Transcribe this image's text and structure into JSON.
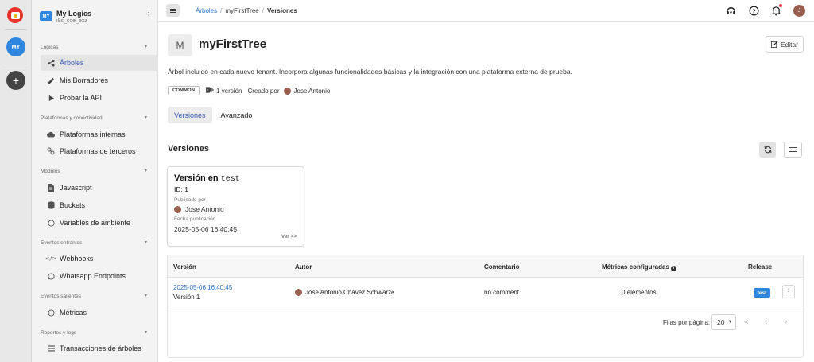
{
  "rail": {
    "workspace_initials": "MY",
    "add_label": "+"
  },
  "org": {
    "badge": "MY",
    "name": "My Logics",
    "id": "i8s_soe_exz",
    "menu": "⋮"
  },
  "sidebar": {
    "sections": [
      {
        "title": "Lógicas",
        "items": [
          {
            "label": "Árboles",
            "icon": "share-icon",
            "active": true
          },
          {
            "label": "Mis Borradores",
            "icon": "edit-icon"
          },
          {
            "label": "Probar la API",
            "icon": "play-icon"
          }
        ]
      },
      {
        "title": "Plataformas y conectividad",
        "items": [
          {
            "label": "Plataformas internas",
            "icon": "cloud-icon"
          },
          {
            "label": "Plataformas de terceros",
            "icon": "nodes-icon"
          }
        ]
      },
      {
        "title": "Módulos",
        "items": [
          {
            "label": "Javascript",
            "icon": "file-icon"
          },
          {
            "label": "Buckets",
            "icon": "database-icon"
          },
          {
            "label": "Variables de ambiente",
            "icon": "circle-icon"
          }
        ]
      },
      {
        "title": "Eventos entrantes",
        "items": [
          {
            "label": "Webhooks",
            "icon": "code-icon"
          },
          {
            "label": "Whatsapp Endpoints",
            "icon": "whatsapp-icon"
          }
        ]
      },
      {
        "title": "Eventos salientes",
        "items": [
          {
            "label": "Métricas",
            "icon": "circle-icon"
          }
        ]
      },
      {
        "title": "Reportes y logs",
        "items": [
          {
            "label": "Transacciones de árboles",
            "icon": "list-icon"
          }
        ]
      }
    ]
  },
  "breadcrumb": {
    "items": [
      "Árboles",
      "myFirstTree",
      "Versiones"
    ],
    "separator": "/"
  },
  "user": {
    "initial": "J"
  },
  "tree": {
    "initial": "M",
    "name": "myFirstTree",
    "edit_label": "Editar",
    "description": "Árbol incluido en cada nuevo tenant. Incorpora algunas funcionalidades básicas y la integración con una plataforma externa de prueba.",
    "tag": "COMMON",
    "versions_count": "1 versión",
    "created_by_label": "Creado por",
    "created_by": "Jose Antonio"
  },
  "tabs": [
    {
      "label": "Versiones",
      "active": true
    },
    {
      "label": "Avanzado",
      "active": false
    }
  ],
  "versions_section": {
    "title": "Versiones"
  },
  "version_card": {
    "title_prefix": "Versión en",
    "env": "test",
    "id": "ID: 1",
    "published_by_label": "Publicado por",
    "published_by": "Jose Antonio",
    "date_label": "Fecha publicación",
    "date": "2025-05-06 16:40:45",
    "more": "Ver >>"
  },
  "table": {
    "headers": {
      "version": "Versión",
      "author": "Autor",
      "comment": "Comentario",
      "metrics": "Métricas configuradas",
      "release": "Release"
    },
    "rows": [
      {
        "date": "2025-05-06 16:40:45",
        "version": "Versión 1",
        "author": "Jose Antonio Chavez Schwarze",
        "comment": "no comment",
        "metrics": "0 elementos",
        "release": "test"
      }
    ],
    "pagination": {
      "rows_per_page_label": "Filas por página:",
      "rows_per_page": "20",
      "first": "«",
      "prev": "‹",
      "next": "›"
    }
  },
  "colors": {
    "accent": "#2e86de",
    "link": "#2f6fc1",
    "brand": "#e8312b"
  }
}
